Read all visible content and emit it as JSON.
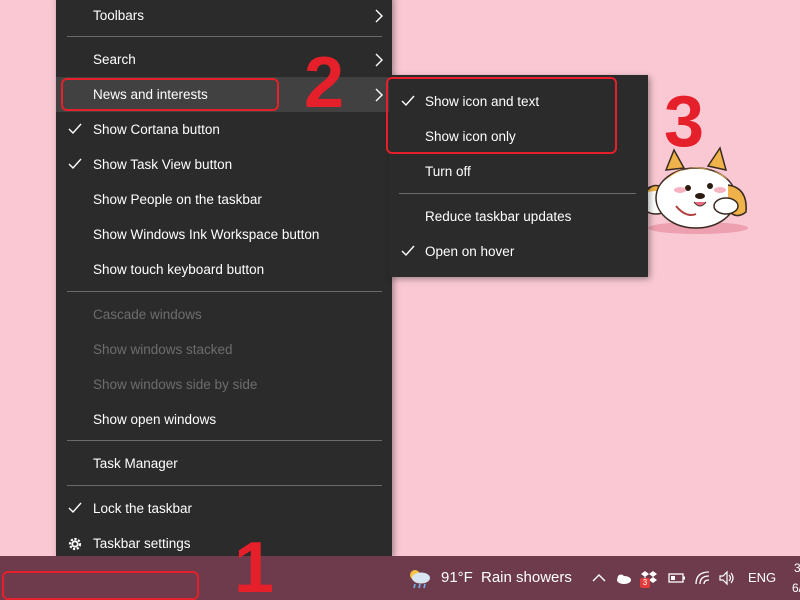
{
  "context_menu": {
    "toolbars": "Toolbars",
    "search": "Search",
    "news_and_interests": "News and interests",
    "show_cortana": "Show Cortana button",
    "show_task_view": "Show Task View button",
    "show_people": "Show People on the taskbar",
    "show_ink_workspace": "Show Windows Ink Workspace button",
    "show_touch_keyboard": "Show touch keyboard button",
    "cascade_windows": "Cascade windows",
    "show_stacked": "Show windows stacked",
    "show_side_by_side": "Show windows side by side",
    "show_open_windows": "Show open windows",
    "task_manager": "Task Manager",
    "lock_taskbar": "Lock the taskbar",
    "taskbar_settings": "Taskbar settings"
  },
  "submenu": {
    "show_icon_and_text": "Show icon and text",
    "show_icon_only": "Show icon only",
    "turn_off": "Turn off",
    "reduce_updates": "Reduce taskbar updates",
    "open_on_hover": "Open on hover"
  },
  "annotations": {
    "step1": "1",
    "step2": "2",
    "step3": "3",
    "color": "#e5202a"
  },
  "taskbar": {
    "temperature": "91°F",
    "weather": "Rain showers",
    "language": "ENG",
    "notification_badge": "3",
    "clock_time_partial": "3",
    "clock_date_partial": "6/"
  },
  "colors": {
    "desktop_bg": "#f9c8d3",
    "menu_bg": "#2b2b2b",
    "taskbar_bg": "#6d3b4b"
  }
}
